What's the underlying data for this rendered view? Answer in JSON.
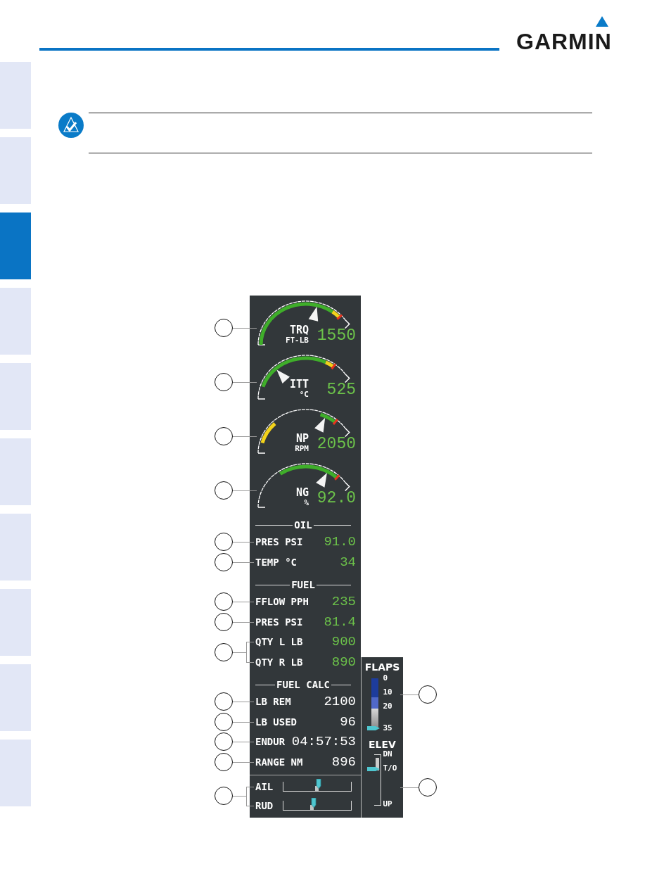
{
  "header": {
    "logo": "GARMIN"
  },
  "side_tabs": [
    {
      "selected": false
    },
    {
      "selected": false
    },
    {
      "selected": true
    },
    {
      "selected": false
    },
    {
      "selected": false
    },
    {
      "selected": false
    },
    {
      "selected": false
    },
    {
      "selected": false
    },
    {
      "selected": false
    },
    {
      "selected": false
    }
  ],
  "display": {
    "gauges": [
      {
        "label": "TRQ",
        "unit": "FT-LB",
        "value": "1550"
      },
      {
        "label": "ITT",
        "unit": "°C",
        "value": "525"
      },
      {
        "label": "NP",
        "unit": "RPM",
        "value": "2050"
      },
      {
        "label": "NG",
        "unit": "%",
        "value": "92.0"
      }
    ],
    "sections": [
      {
        "heading": "OIL",
        "rows": [
          {
            "label": "PRES PSI",
            "value": "91.0",
            "color": "#6cc24a",
            "kind": "line"
          },
          {
            "label": "TEMP °C",
            "value": "34",
            "color": "#6cc24a",
            "kind": "line"
          }
        ]
      },
      {
        "heading": "FUEL",
        "rows": [
          {
            "label": "FFLOW PPH",
            "value": "235",
            "color": "#6cc24a",
            "kind": "line"
          },
          {
            "label": "PRES PSI",
            "value": "81.4",
            "color": "#6cc24a",
            "kind": "line"
          },
          {
            "label": "QTY L LB",
            "value": "900",
            "color": "#6cc24a",
            "kind": "bracket_top"
          },
          {
            "label": "QTY R LB",
            "value": "890",
            "color": "#6cc24a",
            "kind": "bracket_bottom"
          }
        ]
      },
      {
        "heading": "FUEL CALC",
        "rows": [
          {
            "label": "LB REM",
            "value": "2100",
            "color": "#ffffff",
            "kind": "line"
          },
          {
            "label": "LB USED",
            "value": "96",
            "color": "#ffffff",
            "kind": "line"
          },
          {
            "label": "ENDUR",
            "value": "04:57:53",
            "color": "#ffffff",
            "kind": "line"
          },
          {
            "label": "RANGE NM",
            "value": "896",
            "color": "#ffffff",
            "kind": "line"
          }
        ]
      }
    ],
    "trim": [
      {
        "label": "AIL",
        "kind": "bracket_top"
      },
      {
        "label": "RUD",
        "kind": "bracket_bottom"
      }
    ],
    "flaps": {
      "title": "FLAPS",
      "marks": [
        "0",
        "10",
        "20",
        "35"
      ]
    },
    "elevator": {
      "title": "ELEV",
      "marks": [
        "DN",
        "T/O",
        "UP"
      ]
    }
  }
}
